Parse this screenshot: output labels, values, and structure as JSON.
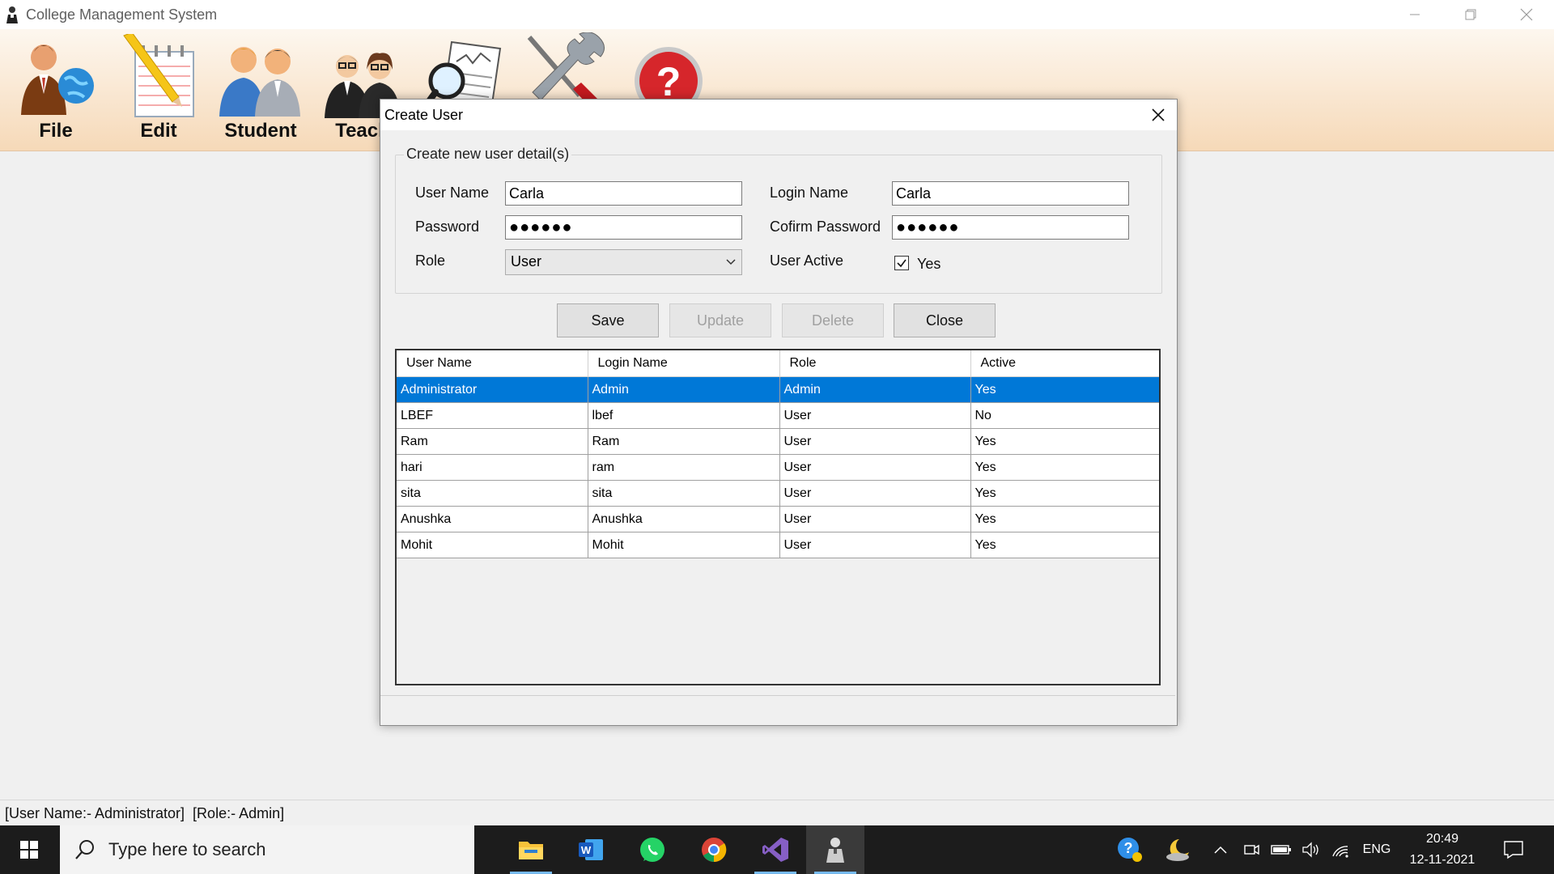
{
  "window": {
    "title": "College Management System"
  },
  "toolbar": {
    "items": [
      {
        "label": "File",
        "icon": "file-person-globe-icon"
      },
      {
        "label": "Edit",
        "icon": "edit-pencil-notepad-icon"
      },
      {
        "label": "Student",
        "icon": "students-icon"
      },
      {
        "label": "Teach",
        "icon": "teachers-icon"
      },
      {
        "label": "",
        "icon": "report-magnifier-icon"
      },
      {
        "label": "",
        "icon": "tools-icon"
      },
      {
        "label": "",
        "icon": "help-question-icon"
      }
    ]
  },
  "dialog": {
    "title": "Create User",
    "group_legend": "Create new user detail(s)",
    "labels": {
      "user_name": "User Name",
      "password": "Password",
      "role": "Role",
      "login_name": "Login Name",
      "confirm_password": "Cofirm Password",
      "user_active": "User Active",
      "active_yes": "Yes"
    },
    "values": {
      "user_name": "Carla",
      "password": "●●●●●●",
      "role": "User",
      "login_name": "Carla",
      "confirm_password": "●●●●●●",
      "user_active": true
    },
    "buttons": {
      "save": "Save",
      "update": "Update",
      "delete": "Delete",
      "close": "Close"
    },
    "grid": {
      "columns": [
        "User Name",
        "Login Name",
        "Role",
        "Active"
      ],
      "rows": [
        [
          "Administrator",
          "Admin",
          "Admin",
          "Yes"
        ],
        [
          "LBEF",
          "lbef",
          "User",
          "No"
        ],
        [
          "Ram",
          "Ram",
          "User",
          "Yes"
        ],
        [
          "hari",
          "ram",
          "User",
          "Yes"
        ],
        [
          "sita",
          "sita",
          "User",
          "Yes"
        ],
        [
          "Anushka",
          "Anushka",
          "User",
          "Yes"
        ],
        [
          "Mohit",
          "Mohit",
          "User",
          "Yes"
        ]
      ],
      "selected_row": 0,
      "selection_color": "#0078d7"
    }
  },
  "status": {
    "text": "[User Name:- Administrator]  [Role:- Admin]"
  },
  "taskbar": {
    "search_placeholder": "Type here to search",
    "apps": [
      "file-explorer-icon",
      "word-icon",
      "whatsapp-icon",
      "chrome-icon",
      "visual-studio-icon",
      "college-app-icon"
    ],
    "language": "ENG",
    "time": "20:49",
    "date": "12-11-2021"
  }
}
